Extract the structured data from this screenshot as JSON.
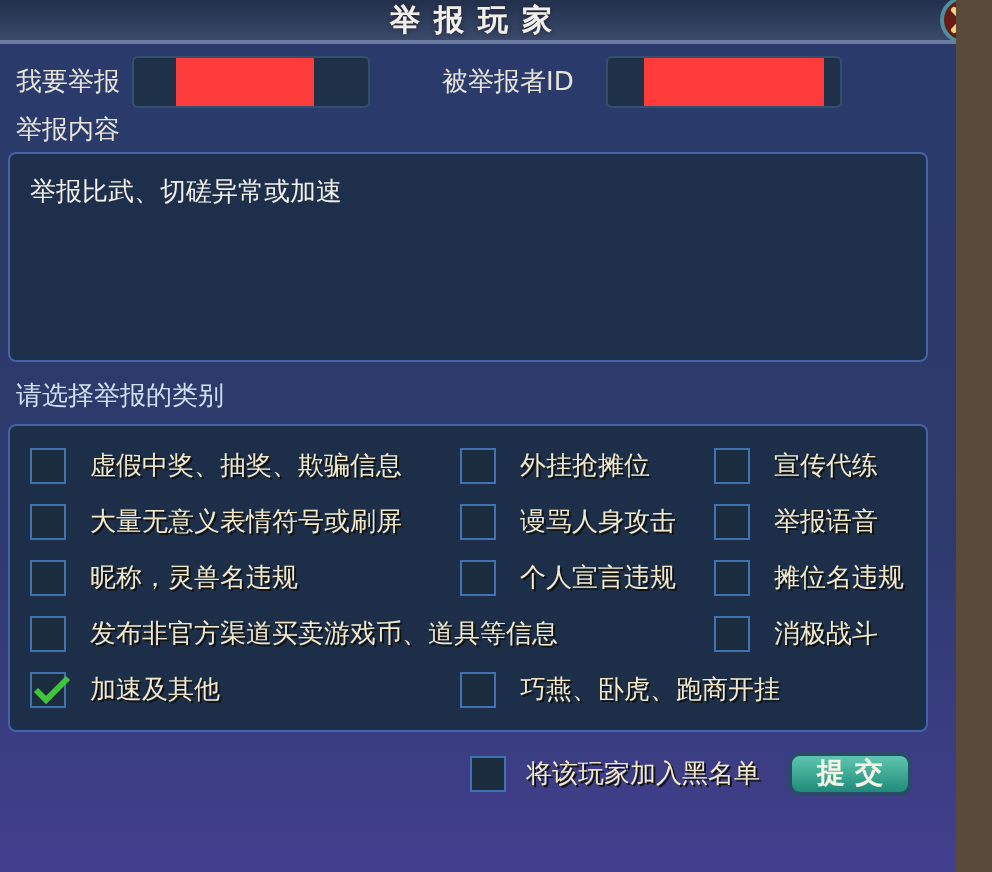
{
  "window": {
    "title": "举报玩家"
  },
  "reporter": {
    "label": "我要举报"
  },
  "reported": {
    "label": "被举报者ID"
  },
  "content": {
    "label": "举报内容",
    "value": "举报比武、切磋异常或加速"
  },
  "categories": {
    "label": "请选择举报的类别",
    "rows": [
      [
        {
          "label": "虚假中奖、抽奖、欺骗信息",
          "checked": false
        },
        {
          "label": "外挂抢摊位",
          "checked": false
        },
        {
          "label": "宣传代练",
          "checked": false
        }
      ],
      [
        {
          "label": "大量无意义表情符号或刷屏",
          "checked": false
        },
        {
          "label": "谩骂人身攻击",
          "checked": false
        },
        {
          "label": "举报语音",
          "checked": false
        }
      ],
      [
        {
          "label": "昵称，灵兽名违规",
          "checked": false
        },
        {
          "label": "个人宣言违规",
          "checked": false
        },
        {
          "label": "摊位名违规",
          "checked": false
        }
      ],
      [
        {
          "label": "发布非官方渠道买卖游戏币、道具等信息",
          "checked": false
        },
        null,
        {
          "label": "消极战斗",
          "checked": false
        }
      ],
      [
        {
          "label": "加速及其他",
          "checked": true
        },
        {
          "label": "巧燕、卧虎、跑商开挂",
          "checked": false
        }
      ]
    ]
  },
  "blacklist": {
    "label": "将该玩家加入黑名单",
    "checked": false
  },
  "submit": {
    "label": "提 交"
  }
}
